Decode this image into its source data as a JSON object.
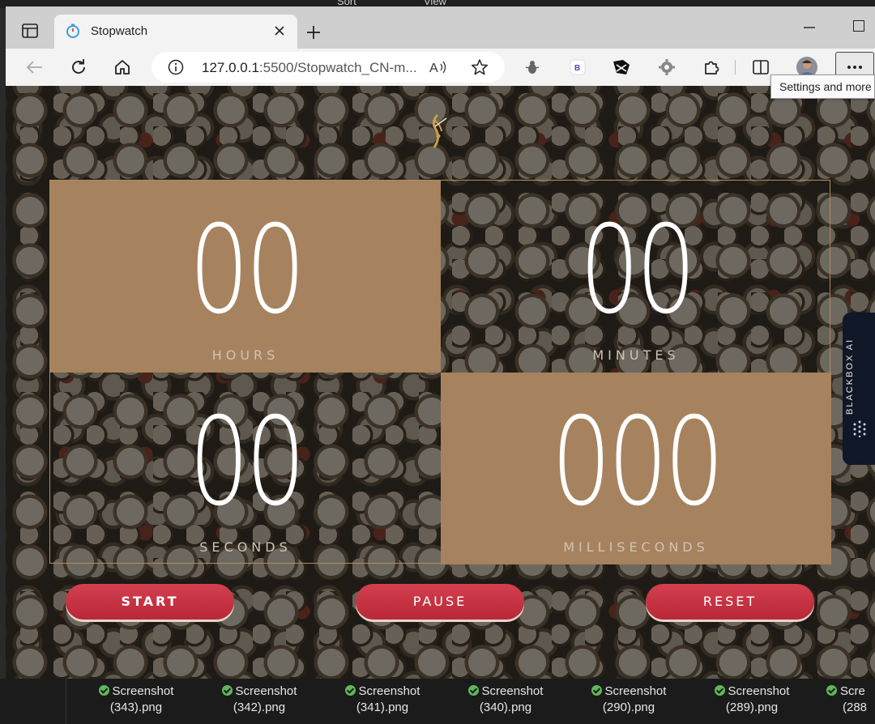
{
  "desktop": {
    "sort_label": "Sort",
    "view_label": "View"
  },
  "browser": {
    "tab": {
      "title": "Stopwatch"
    },
    "address": {
      "host": "127.0.0.1",
      "path": ":5500/Stopwatch_CN-m..."
    },
    "tooltip": "Settings and more"
  },
  "stopwatch": {
    "hours": "00",
    "minutes": "00",
    "seconds": "00",
    "milliseconds": "000",
    "labels": {
      "hours": "HOURS",
      "minutes": "MINUTES",
      "seconds": "SECONDS",
      "milliseconds": "MILLISECONDS"
    },
    "buttons": {
      "start": "START",
      "pause": "PAUSE",
      "reset": "RESET"
    },
    "colors": {
      "cell_fill": "#a7825e",
      "button": "#c93344",
      "border": "#b08e62"
    }
  },
  "sidebar": {
    "blackbox_label": "BLACKBOX AI"
  },
  "files": [
    {
      "name": "Screenshot",
      "ext": "(343).png"
    },
    {
      "name": "Screenshot",
      "ext": "(342).png"
    },
    {
      "name": "Screenshot",
      "ext": "(341).png"
    },
    {
      "name": "Screenshot",
      "ext": "(340).png"
    },
    {
      "name": "Screenshot",
      "ext": "(290).png"
    },
    {
      "name": "Screenshot",
      "ext": "(289).png"
    },
    {
      "name": "Scre",
      "ext": "(288"
    }
  ]
}
